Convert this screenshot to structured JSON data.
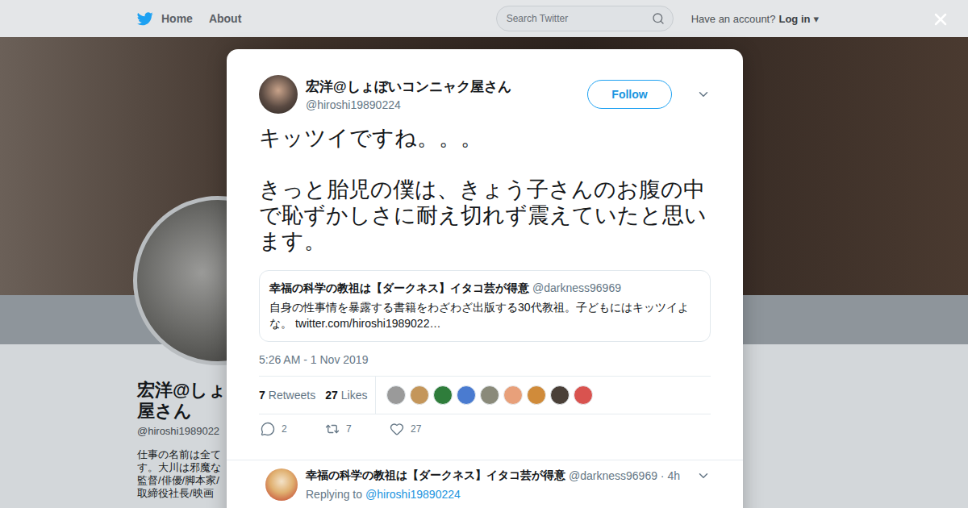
{
  "nav": {
    "links": [
      "Home",
      "About"
    ],
    "search": {
      "placeholder": "Search Twitter"
    },
    "account_prompt": "Have an account?",
    "login": "Log in",
    "login_caret": "▾"
  },
  "profile": {
    "name_lines": [
      "宏洋@しょ",
      "屋さん"
    ],
    "handle": "@hiroshi1989022",
    "bio_lines": [
      "仕事の名前は全て",
      "す。大川は邪魔な",
      "監督/俳優/脚本家/",
      "取締役社長/映画"
    ]
  },
  "tweet": {
    "author": {
      "name": "宏洋@しょぼいコンニャク屋さん",
      "handle": "@hiroshi19890224"
    },
    "follow_button": "Follow",
    "text": "キッツイですね。。。\n\nきっと胎児の僕は、きょう子さんのお腹の中で恥ずかしさに耐え切れず震えていたと思います。",
    "quoted": {
      "name": "幸福の科学の教祖は【ダークネス】イタコ芸が得意",
      "handle": "@darkness96969",
      "text": "自身の性事情を暴露する書籍をわざわざ出版する30代教祖。子どもにはキッツイよな。",
      "link": "twitter.com/hiroshi1989022…"
    },
    "time": "5:26 AM - 1 Nov 2019",
    "retweets": {
      "count": "7",
      "label": "Retweets"
    },
    "likes": {
      "count": "27",
      "label": "Likes"
    },
    "likers": [
      {
        "color": "#9a9a9a"
      },
      {
        "color": "#c4965a"
      },
      {
        "color": "#2f7d3b"
      },
      {
        "color": "#4a7bd0"
      },
      {
        "color": "#8a8a7a"
      },
      {
        "color": "#e8a07a"
      },
      {
        "color": "#d08b3a"
      },
      {
        "color": "#4a4038"
      },
      {
        "color": "#d9534f"
      }
    ],
    "actions": [
      {
        "kind": "reply",
        "count": "2"
      },
      {
        "kind": "retweet",
        "count": "7"
      },
      {
        "kind": "like",
        "count": "27"
      }
    ]
  },
  "replies": [
    {
      "name": "幸福の科学の教祖は【ダークネス】イタコ芸が得意",
      "handle": "@darkness96969",
      "separator": "·",
      "time": "4h",
      "replying_label": "Replying to",
      "replying_to": "@hiroshi19890224"
    }
  ]
}
